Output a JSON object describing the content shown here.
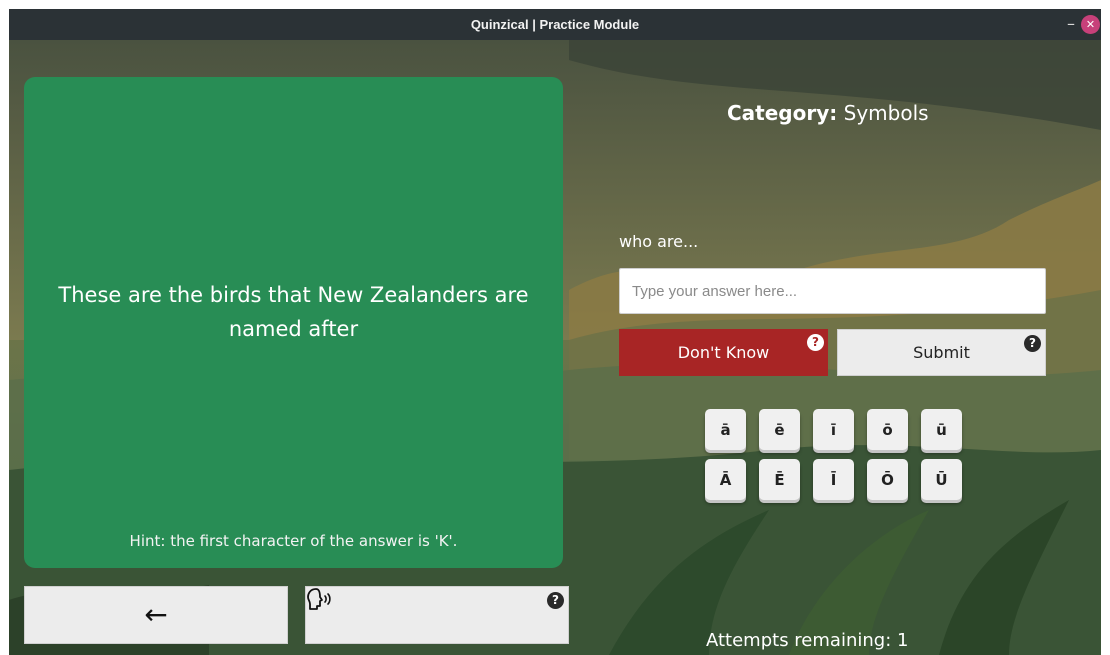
{
  "window": {
    "title": "Quinzical | Practice Module",
    "minimize_glyph": "–",
    "close_glyph": "✕"
  },
  "question": {
    "text": "These are the birds that New Zealanders are named after",
    "hint": "Hint: the first character of the answer is 'K'."
  },
  "bottom_buttons": {
    "back_glyph": "←",
    "speak_icon": "speak-icon",
    "help_glyph": "?"
  },
  "category": {
    "label": "Category:",
    "value": "Symbols"
  },
  "answer": {
    "prefix": "who are...",
    "placeholder": "Type your answer here...",
    "value": ""
  },
  "actions": {
    "dont_know_label": "Don't Know",
    "submit_label": "Submit",
    "help_glyph": "?"
  },
  "macron_keys": {
    "lowercase": [
      "ā",
      "ē",
      "ī",
      "ō",
      "ū"
    ],
    "uppercase": [
      "Ā",
      "Ē",
      "Ī",
      "Ō",
      "Ū"
    ]
  },
  "attempts": {
    "text": "Attempts remaining: 1"
  },
  "colors": {
    "card_green": "#288d55",
    "dont_know_red": "#a82525",
    "titlebar": "#2b3236",
    "close_button": "#c7407a"
  }
}
